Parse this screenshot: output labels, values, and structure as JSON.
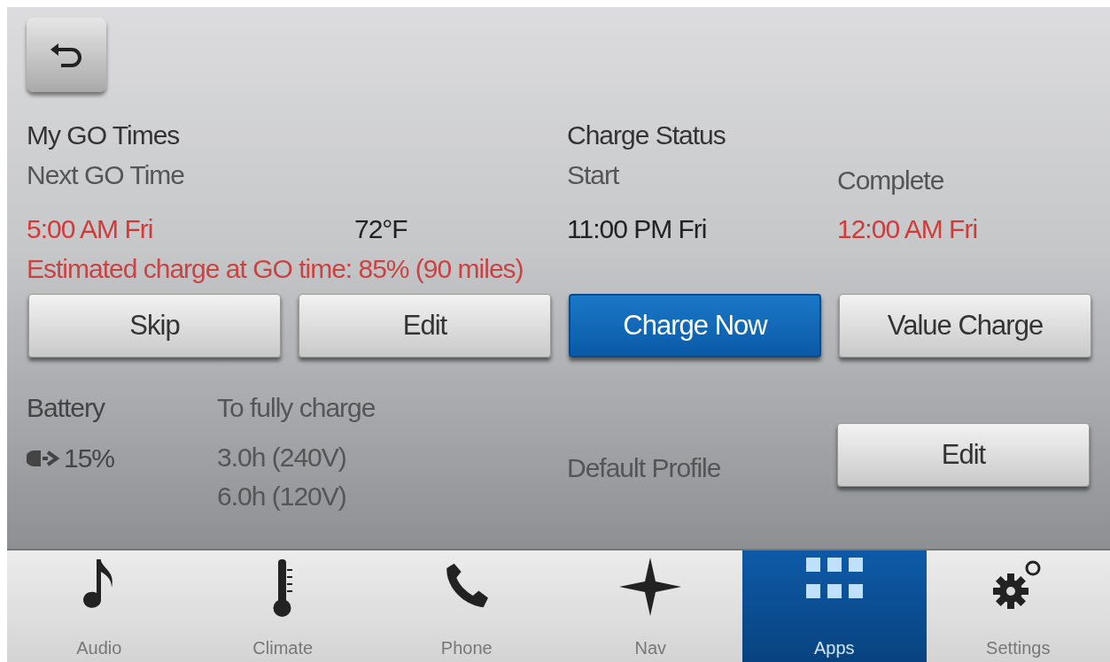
{
  "go_times": {
    "title": "My GO Times",
    "subtitle": "Next GO Time",
    "time": "5:00 AM Fri",
    "temperature": "72°F"
  },
  "charge_status": {
    "title": "Charge Status",
    "start_label": "Start",
    "start_time": "11:00 PM Fri",
    "complete_label": "Complete",
    "complete_time": "12:00 AM Fri"
  },
  "estimate": "Estimated charge at GO time: 85% (90 miles)",
  "actions": [
    {
      "label": "Skip",
      "selected": false
    },
    {
      "label": "Edit",
      "selected": false
    },
    {
      "label": "Charge Now",
      "selected": true
    },
    {
      "label": "Value Charge",
      "selected": false
    }
  ],
  "battery": {
    "label": "Battery",
    "value": "15%"
  },
  "full_charge": {
    "label": "To fully charge",
    "times": [
      "3.0h (240V)",
      "6.0h (120V)"
    ]
  },
  "profile": {
    "label": "Default Profile",
    "button": "Edit"
  },
  "nav": [
    {
      "kind": "audio",
      "label": "Audio",
      "selected": false
    },
    {
      "kind": "climate",
      "label": "Climate",
      "selected": false
    },
    {
      "kind": "phone",
      "label": "Phone",
      "selected": false
    },
    {
      "kind": "nav",
      "label": "Nav",
      "selected": false
    },
    {
      "kind": "apps",
      "label": "Apps",
      "selected": true
    },
    {
      "kind": "settings",
      "label": "Settings",
      "selected": false
    }
  ]
}
